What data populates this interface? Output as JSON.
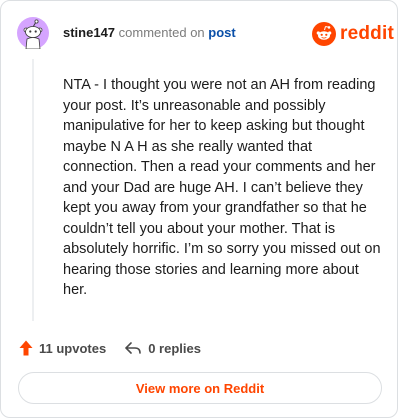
{
  "header": {
    "username": "stine147",
    "action_text": "commented on",
    "post_link": "post",
    "logo_text": "reddit"
  },
  "comment": {
    "body": "NTA - I thought you were not an AH from reading your post. It’s unreasonable and possibly manipulative for her to keep asking but thought maybe N A H as she really wanted that connection. Then a read your comments and her and your Dad are huge AH. I can’t believe they kept you away from your grandfather so that he couldn’t tell you about your mother. That is absolutely horrific. I’m so sorry you missed out on hearing those stories and learning more about her."
  },
  "actions": {
    "upvotes": "11 upvotes",
    "replies": "0 replies"
  },
  "footer": {
    "view_more": "View more on Reddit"
  },
  "colors": {
    "brand": "#ff4500",
    "link": "#0a4fa8",
    "avatar_bg": "#d5a4ff"
  },
  "icons": {
    "avatar": "snoo-avatar-icon",
    "logo": "reddit-snoo-icon",
    "upvote": "upvote-arrow-icon",
    "reply": "reply-arrow-icon"
  }
}
